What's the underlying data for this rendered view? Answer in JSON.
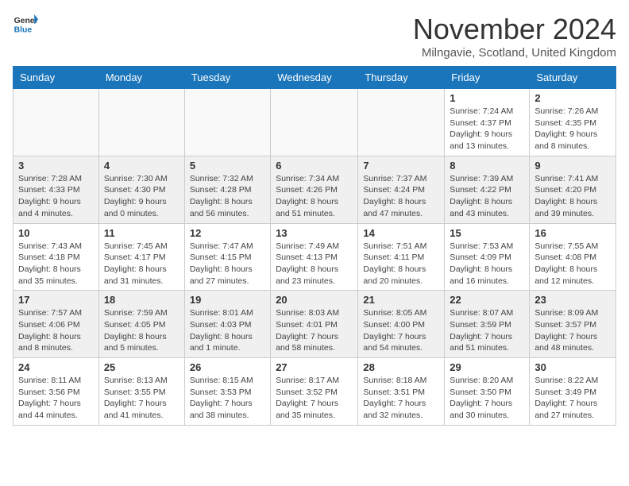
{
  "logo": {
    "line1": "General",
    "line2": "Blue"
  },
  "title": "November 2024",
  "location": "Milngavie, Scotland, United Kingdom",
  "headers": [
    "Sunday",
    "Monday",
    "Tuesday",
    "Wednesday",
    "Thursday",
    "Friday",
    "Saturday"
  ],
  "weeks": [
    [
      {
        "day": "",
        "info": ""
      },
      {
        "day": "",
        "info": ""
      },
      {
        "day": "",
        "info": ""
      },
      {
        "day": "",
        "info": ""
      },
      {
        "day": "",
        "info": ""
      },
      {
        "day": "1",
        "info": "Sunrise: 7:24 AM\nSunset: 4:37 PM\nDaylight: 9 hours and 13 minutes."
      },
      {
        "day": "2",
        "info": "Sunrise: 7:26 AM\nSunset: 4:35 PM\nDaylight: 9 hours and 8 minutes."
      }
    ],
    [
      {
        "day": "3",
        "info": "Sunrise: 7:28 AM\nSunset: 4:33 PM\nDaylight: 9 hours and 4 minutes."
      },
      {
        "day": "4",
        "info": "Sunrise: 7:30 AM\nSunset: 4:30 PM\nDaylight: 9 hours and 0 minutes."
      },
      {
        "day": "5",
        "info": "Sunrise: 7:32 AM\nSunset: 4:28 PM\nDaylight: 8 hours and 56 minutes."
      },
      {
        "day": "6",
        "info": "Sunrise: 7:34 AM\nSunset: 4:26 PM\nDaylight: 8 hours and 51 minutes."
      },
      {
        "day": "7",
        "info": "Sunrise: 7:37 AM\nSunset: 4:24 PM\nDaylight: 8 hours and 47 minutes."
      },
      {
        "day": "8",
        "info": "Sunrise: 7:39 AM\nSunset: 4:22 PM\nDaylight: 8 hours and 43 minutes."
      },
      {
        "day": "9",
        "info": "Sunrise: 7:41 AM\nSunset: 4:20 PM\nDaylight: 8 hours and 39 minutes."
      }
    ],
    [
      {
        "day": "10",
        "info": "Sunrise: 7:43 AM\nSunset: 4:18 PM\nDaylight: 8 hours and 35 minutes."
      },
      {
        "day": "11",
        "info": "Sunrise: 7:45 AM\nSunset: 4:17 PM\nDaylight: 8 hours and 31 minutes."
      },
      {
        "day": "12",
        "info": "Sunrise: 7:47 AM\nSunset: 4:15 PM\nDaylight: 8 hours and 27 minutes."
      },
      {
        "day": "13",
        "info": "Sunrise: 7:49 AM\nSunset: 4:13 PM\nDaylight: 8 hours and 23 minutes."
      },
      {
        "day": "14",
        "info": "Sunrise: 7:51 AM\nSunset: 4:11 PM\nDaylight: 8 hours and 20 minutes."
      },
      {
        "day": "15",
        "info": "Sunrise: 7:53 AM\nSunset: 4:09 PM\nDaylight: 8 hours and 16 minutes."
      },
      {
        "day": "16",
        "info": "Sunrise: 7:55 AM\nSunset: 4:08 PM\nDaylight: 8 hours and 12 minutes."
      }
    ],
    [
      {
        "day": "17",
        "info": "Sunrise: 7:57 AM\nSunset: 4:06 PM\nDaylight: 8 hours and 8 minutes."
      },
      {
        "day": "18",
        "info": "Sunrise: 7:59 AM\nSunset: 4:05 PM\nDaylight: 8 hours and 5 minutes."
      },
      {
        "day": "19",
        "info": "Sunrise: 8:01 AM\nSunset: 4:03 PM\nDaylight: 8 hours and 1 minute."
      },
      {
        "day": "20",
        "info": "Sunrise: 8:03 AM\nSunset: 4:01 PM\nDaylight: 7 hours and 58 minutes."
      },
      {
        "day": "21",
        "info": "Sunrise: 8:05 AM\nSunset: 4:00 PM\nDaylight: 7 hours and 54 minutes."
      },
      {
        "day": "22",
        "info": "Sunrise: 8:07 AM\nSunset: 3:59 PM\nDaylight: 7 hours and 51 minutes."
      },
      {
        "day": "23",
        "info": "Sunrise: 8:09 AM\nSunset: 3:57 PM\nDaylight: 7 hours and 48 minutes."
      }
    ],
    [
      {
        "day": "24",
        "info": "Sunrise: 8:11 AM\nSunset: 3:56 PM\nDaylight: 7 hours and 44 minutes."
      },
      {
        "day": "25",
        "info": "Sunrise: 8:13 AM\nSunset: 3:55 PM\nDaylight: 7 hours and 41 minutes."
      },
      {
        "day": "26",
        "info": "Sunrise: 8:15 AM\nSunset: 3:53 PM\nDaylight: 7 hours and 38 minutes."
      },
      {
        "day": "27",
        "info": "Sunrise: 8:17 AM\nSunset: 3:52 PM\nDaylight: 7 hours and 35 minutes."
      },
      {
        "day": "28",
        "info": "Sunrise: 8:18 AM\nSunset: 3:51 PM\nDaylight: 7 hours and 32 minutes."
      },
      {
        "day": "29",
        "info": "Sunrise: 8:20 AM\nSunset: 3:50 PM\nDaylight: 7 hours and 30 minutes."
      },
      {
        "day": "30",
        "info": "Sunrise: 8:22 AM\nSunset: 3:49 PM\nDaylight: 7 hours and 27 minutes."
      }
    ]
  ]
}
